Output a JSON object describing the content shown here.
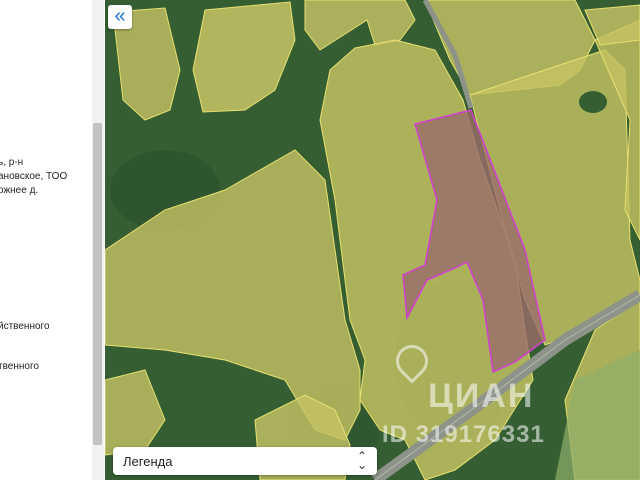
{
  "sidebar": {
    "fragments": [
      "ь, р-н",
      "ановское, ТОО",
      "ожнее д.",
      "йственного",
      "твенного"
    ]
  },
  "map": {
    "collapse_icon": "«",
    "legend_label": "Легенда",
    "legend_icon": "chevron-up-down-icon",
    "watermark_brand": "ЦИАН",
    "watermark_id": "ID 319176331",
    "colors": {
      "forest": "#355f33",
      "field_overlay": "#c9c463",
      "boundary": "#e8e070",
      "highlight_parcel": "#9a6b6a",
      "highlight_border": "#d23fd0",
      "road": "#8d9388"
    }
  }
}
